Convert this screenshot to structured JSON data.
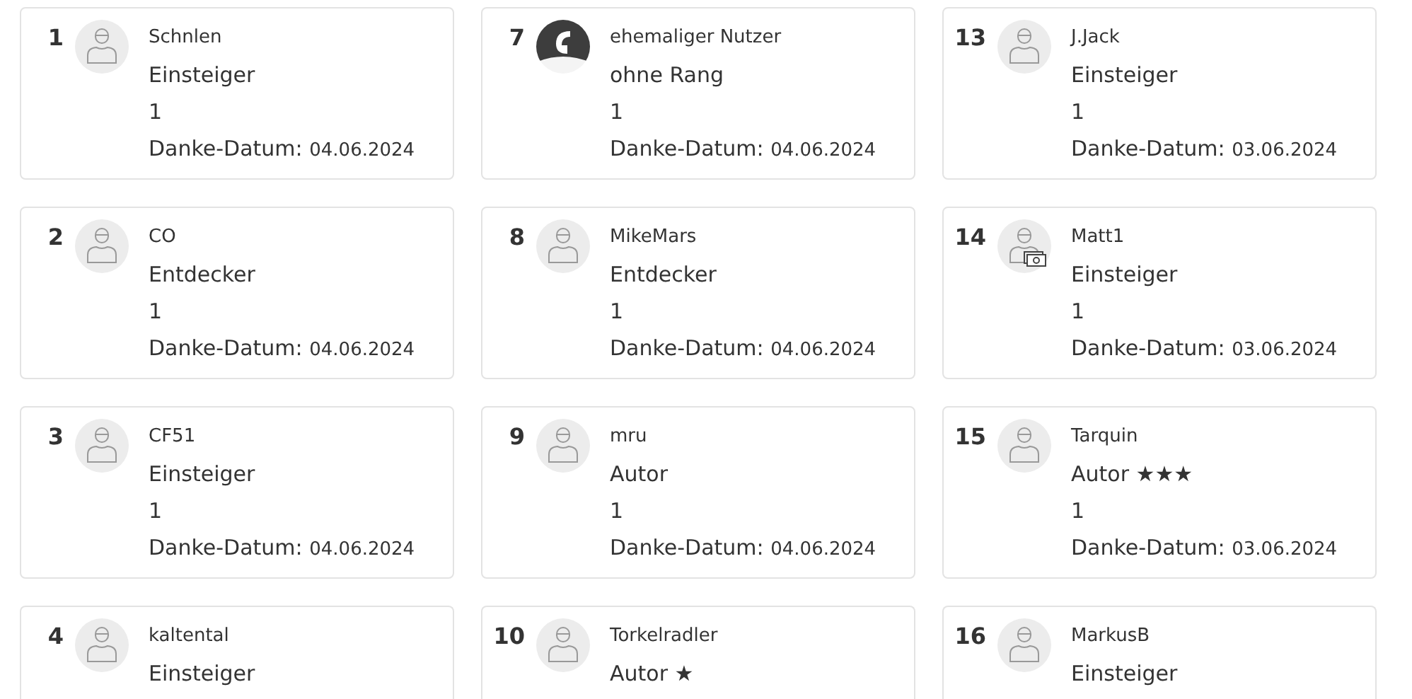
{
  "entries": [
    {
      "rank": "1",
      "kind": "member",
      "name": "Schnlen",
      "level": "Einsteiger",
      "count": "1",
      "date_label": "Danke-Datum:",
      "date": "04.06.2024"
    },
    {
      "rank": "2",
      "kind": "member",
      "name": "CO",
      "level": "Entdecker",
      "count": "1",
      "date_label": "Danke-Datum:",
      "date": "04.06.2024"
    },
    {
      "rank": "3",
      "kind": "member",
      "name": "CF51",
      "level": "Einsteiger",
      "count": "1",
      "date_label": "Danke-Datum:",
      "date": "04.06.2024"
    },
    {
      "rank": "4",
      "kind": "member",
      "name": "kaltental",
      "level": "Einsteiger"
    },
    {
      "rank": "7",
      "kind": "deleted",
      "name": "ehemaliger Nutzer",
      "level": "ohne Rang",
      "count": "1",
      "date_label": "Danke-Datum:",
      "date": "04.06.2024"
    },
    {
      "rank": "8",
      "kind": "member",
      "name": "MikeMars",
      "level": "Entdecker",
      "count": "1",
      "date_label": "Danke-Datum:",
      "date": "04.06.2024"
    },
    {
      "rank": "9",
      "kind": "member",
      "name": "mru",
      "level": "Autor",
      "count": "1",
      "date_label": "Danke-Datum:",
      "date": "04.06.2024"
    },
    {
      "rank": "10",
      "kind": "member",
      "name": "Torkelradler",
      "level": "Autor ★"
    },
    {
      "rank": "13",
      "kind": "member",
      "name": "J.Jack",
      "level": "Einsteiger",
      "count": "1",
      "date_label": "Danke-Datum:",
      "date": "03.06.2024"
    },
    {
      "rank": "14",
      "kind": "trader",
      "name": "Matt1",
      "level": "Einsteiger",
      "count": "1",
      "date_label": "Danke-Datum:",
      "date": "03.06.2024"
    },
    {
      "rank": "15",
      "kind": "member",
      "name": "Tarquin",
      "level": "Autor ★★★",
      "count": "1",
      "date_label": "Danke-Datum:",
      "date": "03.06.2024"
    },
    {
      "rank": "16",
      "kind": "member",
      "name": "MarkusB",
      "level": "Einsteiger"
    }
  ]
}
